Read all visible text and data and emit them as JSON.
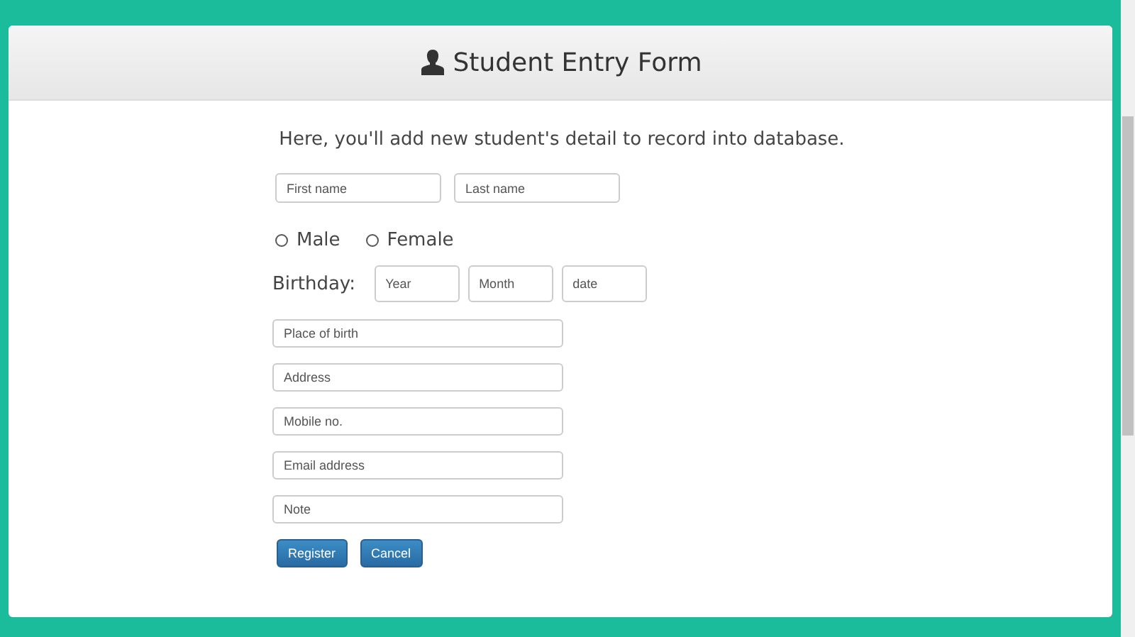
{
  "form": {
    "title": "Student Entry Form",
    "intro": "Here, you'll add new student's detail to record into database.",
    "name_fields": [
      {
        "placeholder": "First name"
      },
      {
        "placeholder": "Last name"
      }
    ],
    "gender": [
      {
        "label": "Male",
        "selected": false
      },
      {
        "label": "Female",
        "selected": false
      }
    ],
    "birthday_label": "Birthday:",
    "birthday_fields": [
      {
        "placeholder": "Year"
      },
      {
        "placeholder": "Month"
      },
      {
        "placeholder": "date"
      }
    ],
    "fields": [
      {
        "placeholder": "Place of birth"
      },
      {
        "placeholder": "Address"
      },
      {
        "placeholder": "Mobile no."
      },
      {
        "placeholder": "Email address"
      },
      {
        "placeholder": "Note"
      }
    ],
    "buttons": [
      "Register",
      "Cancel"
    ]
  }
}
